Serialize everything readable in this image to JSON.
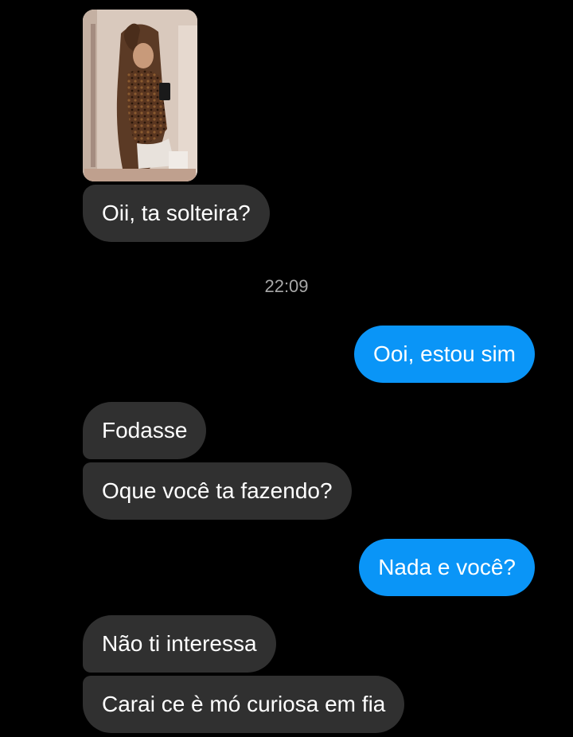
{
  "colors": {
    "background": "#000000",
    "incoming_bubble": "#303030",
    "outgoing_bubble": "#0a95f7",
    "timestamp_text": "#a8a8a8"
  },
  "photo": {
    "icon": "photo-of-woman-mirror-selfie"
  },
  "messages_before": [
    {
      "sender": "them",
      "text": "Oii, ta solteira?"
    }
  ],
  "timestamp": "22:09",
  "messages_after": [
    {
      "sender": "me",
      "text": "Ooi, estou sim"
    },
    {
      "sender": "them",
      "text": "Fodasse"
    },
    {
      "sender": "them",
      "text": "Oque você ta fazendo?"
    },
    {
      "sender": "me",
      "text": "Nada e você?"
    },
    {
      "sender": "them",
      "text": "Não ti interessa"
    },
    {
      "sender": "them",
      "text": "Carai ce è mó curiosa em fia"
    }
  ]
}
